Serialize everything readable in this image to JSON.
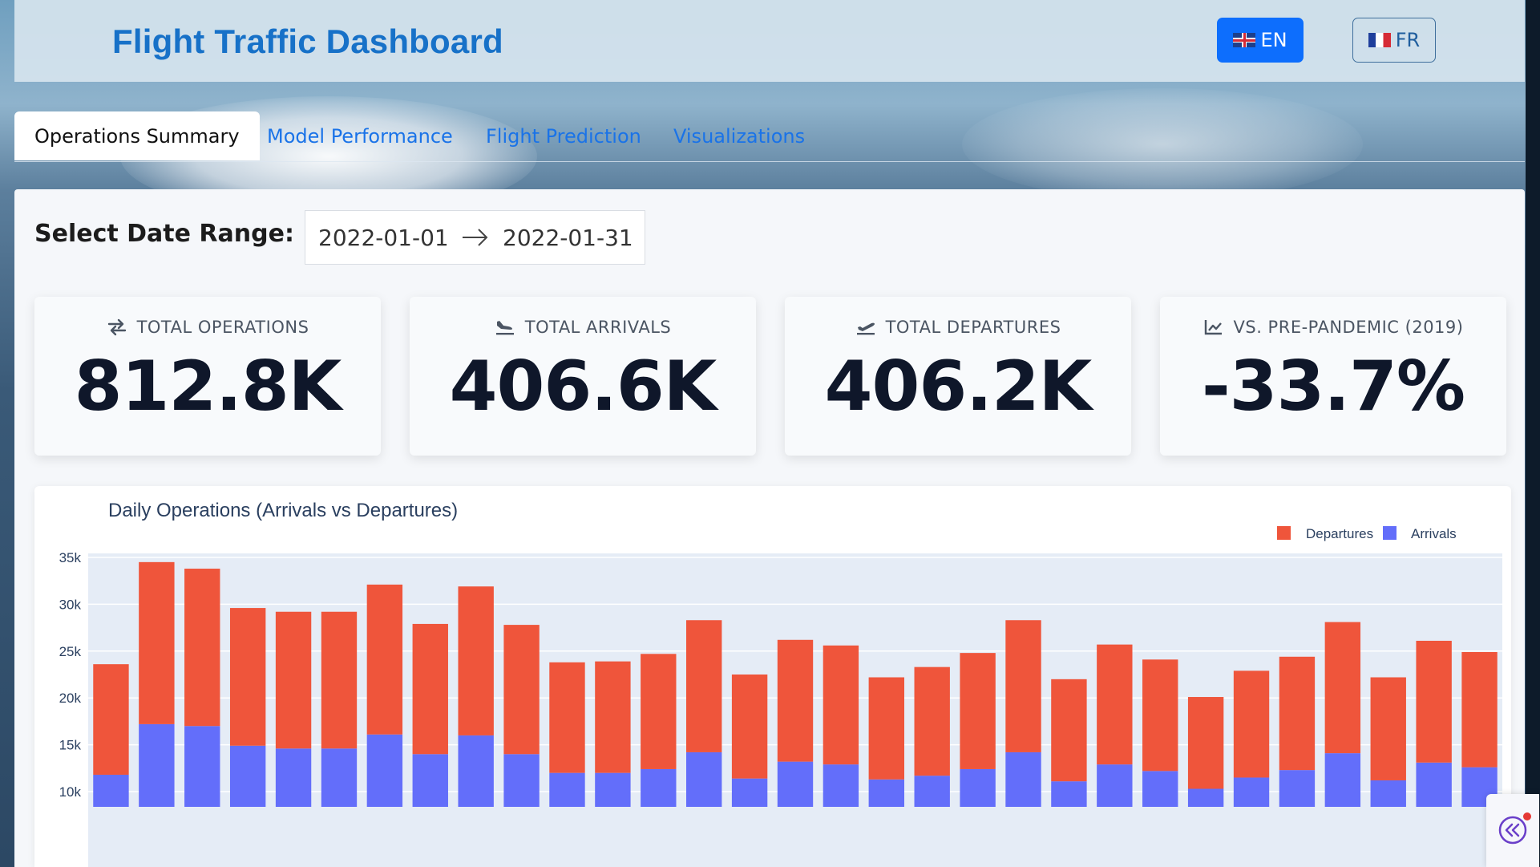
{
  "header": {
    "title": "Flight Traffic Dashboard",
    "lang_en": "EN",
    "lang_fr": "FR"
  },
  "tabs": [
    {
      "label": "Operations Summary",
      "active": true
    },
    {
      "label": "Model Performance",
      "active": false
    },
    {
      "label": "Flight Prediction",
      "active": false
    },
    {
      "label": "Visualizations",
      "active": false
    }
  ],
  "date_range": {
    "label": "Select Date Range:",
    "start": "2022-01-01",
    "end": "2022-01-31"
  },
  "kpis": [
    {
      "label": "TOTAL OPERATIONS",
      "value": "812.8K",
      "icon": "exchange-arrows-icon"
    },
    {
      "label": "TOTAL ARRIVALS",
      "value": "406.6K",
      "icon": "plane-arrival-icon"
    },
    {
      "label": "TOTAL DEPARTURES",
      "value": "406.2K",
      "icon": "plane-departure-icon"
    },
    {
      "label": "VS. PRE-PANDEMIC (2019)",
      "value": "-33.7%",
      "icon": "line-chart-icon"
    }
  ],
  "colors": {
    "departures": "#ef553b",
    "arrivals": "#636efa",
    "primary": "#0d6efd",
    "title": "#1771c8"
  },
  "chart_data": {
    "type": "bar",
    "stacked": true,
    "title": "Daily Operations (Arrivals vs Departures)",
    "legend_position": "top-right",
    "y_ticks": [
      "10k",
      "15k",
      "20k",
      "25k",
      "30k",
      "35k"
    ],
    "grid": true,
    "series": [
      {
        "name": "Arrivals",
        "color": "#636efa",
        "values": [
          11800,
          17200,
          17000,
          14900,
          14600,
          14600,
          16100,
          14000,
          16000,
          14000,
          12000,
          12000,
          12400,
          14200,
          11400,
          13200,
          12900,
          11300,
          11700,
          12400,
          14200,
          11100,
          12900,
          12200,
          10300,
          11500,
          12300,
          14100,
          11200,
          13100,
          12600
        ]
      },
      {
        "name": "Departures",
        "color": "#ef553b",
        "values": [
          11800,
          17300,
          16800,
          14700,
          14600,
          14600,
          16000,
          13900,
          15900,
          13800,
          11800,
          11900,
          12300,
          14100,
          11100,
          13000,
          12700,
          10900,
          11600,
          12400,
          14100,
          10900,
          12800,
          11900,
          9800,
          11400,
          12100,
          14000,
          11000,
          13000,
          12300
        ]
      }
    ],
    "totals": [
      23600,
      34500,
      33800,
      29600,
      29200,
      29200,
      32100,
      27900,
      31900,
      27800,
      23800,
      23900,
      24700,
      28300,
      22500,
      26200,
      25600,
      22200,
      23300,
      24800,
      28300,
      22000,
      25700,
      24100,
      20100,
      22900,
      24400,
      28100,
      22200,
      26100,
      24900
    ]
  },
  "legend": {
    "departures": "Departures",
    "arrivals": "Arrivals"
  },
  "float_button": {
    "icon": "chevrons-left-icon",
    "has_notification": true
  }
}
